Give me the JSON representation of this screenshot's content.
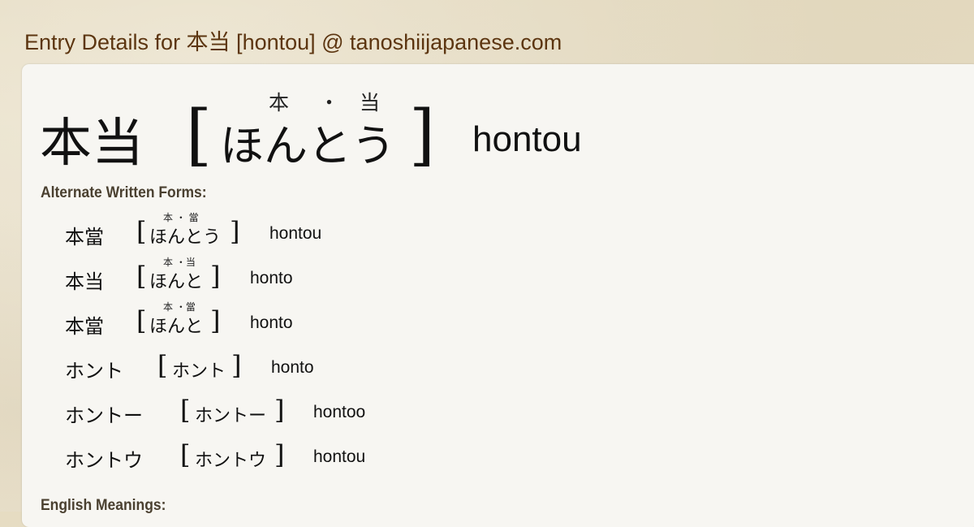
{
  "page": {
    "title": "Entry Details for 本当 [hontou] @ tanoshiijapanese.com"
  },
  "entry": {
    "kanji": "本当",
    "furigana": [
      "本",
      "・",
      "当"
    ],
    "kana": "ほんとう",
    "romaji": "hontou",
    "bracket_open": "[",
    "bracket_close": "]"
  },
  "alternate_forms": {
    "label": "Alternate Written Forms:",
    "items": [
      {
        "kanji": "本當",
        "furigana": "本 ・ 當",
        "kana": "ほんとう",
        "romaji": "hontou"
      },
      {
        "kanji": "本当",
        "furigana": "本 ・当",
        "kana": "ほんと",
        "romaji": "honto"
      },
      {
        "kanji": "本當",
        "furigana": "本 ・當",
        "kana": "ほんと",
        "romaji": "honto"
      },
      {
        "kanji": "ホント",
        "furigana": "",
        "kana": "ホント",
        "romaji": "honto"
      },
      {
        "kanji": "ホントー",
        "furigana": "",
        "kana": "ホントー",
        "romaji": "hontoo"
      },
      {
        "kanji": "ホントウ",
        "furigana": "",
        "kana": "ホントウ",
        "romaji": "hontou"
      }
    ]
  },
  "english_meanings": {
    "label": "English Meanings:"
  }
}
